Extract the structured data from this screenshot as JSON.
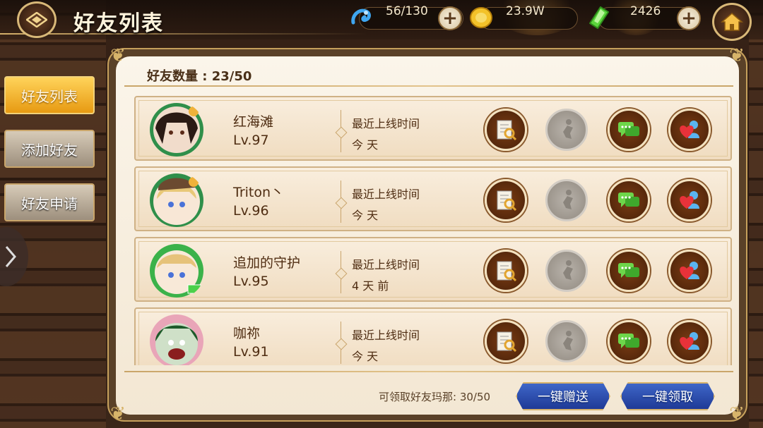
{
  "header": {
    "title": "好友列表"
  },
  "resources": [
    {
      "icon": "blue-dragon-icon",
      "value": "56/130"
    },
    {
      "icon": "gold-coin-icon",
      "value": "23.9W"
    },
    {
      "icon": "green-crystal-icon",
      "value": "2426"
    }
  ],
  "tabs": [
    {
      "label": "好友列表",
      "active": true
    },
    {
      "label": "添加好友",
      "active": false
    },
    {
      "label": "好友申请",
      "active": false
    }
  ],
  "panel": {
    "count_label": "好友数量 : 23/50"
  },
  "online_label": "最近上线时间",
  "friends": [
    {
      "name": "红海滩",
      "level": "Lv.97",
      "last_online": "今 天"
    },
    {
      "name": "Triton丶",
      "level": "Lv.96",
      "last_online": "今 天"
    },
    {
      "name": "追加的守护",
      "level": "Lv.95",
      "last_online": "4 天 前"
    },
    {
      "name": "咖祢",
      "level": "Lv.91",
      "last_online": "今 天"
    }
  ],
  "footer": {
    "claim_text": "可领取好友玛那: 30/50",
    "send_all": "一键赠送",
    "claim_all": "一键领取"
  },
  "colors": {
    "accent": "#e79a12",
    "panel": "#f6ecdb",
    "button_blue": "#2a4aa8"
  }
}
